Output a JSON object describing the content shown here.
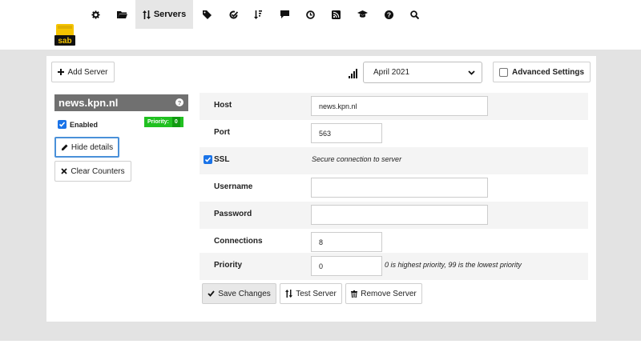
{
  "nav": {
    "logo_text": "sab",
    "active_label": "Servers",
    "icons": [
      "gear-icon",
      "folder-icon",
      "servers-icon",
      "tag-icon",
      "check-circle-icon",
      "sort-icon",
      "comment-icon",
      "clock-icon",
      "rss-icon",
      "graduation-cap-icon",
      "question-circle-icon",
      "search-icon"
    ]
  },
  "toolbar": {
    "add_server_label": "Add Server",
    "month_select": "April 2021",
    "advanced_settings_label": "Advanced Settings",
    "advanced_settings_checked": false
  },
  "server": {
    "name": "news.kpn.nl",
    "enabled_label": "Enabled",
    "enabled_checked": true,
    "priority_badge_label": "Priority:",
    "priority_badge_value": "0",
    "hide_details_label": "Hide details",
    "clear_counters_label": "Clear Counters"
  },
  "form": {
    "host_label": "Host",
    "host_value": "news.kpn.nl",
    "port_label": "Port",
    "port_value": "563",
    "ssl_label": "SSL",
    "ssl_checked": true,
    "ssl_hint": "Secure connection to server",
    "username_label": "Username",
    "username_value": "",
    "password_label": "Password",
    "password_value": "",
    "connections_label": "Connections",
    "connections_value": "8",
    "priority_label": "Priority",
    "priority_value": "0",
    "priority_hint": "0 is highest priority, 99 is the lowest priority"
  },
  "actions": {
    "save_label": "Save Changes",
    "test_label": "Test Server",
    "remove_label": "Remove Server"
  },
  "colors": {
    "accent_blue": "#1a73e8",
    "badge_green": "#20c020",
    "header_gray": "#707070",
    "page_gray": "#e3e3e3",
    "logo_yellow": "#f5c400"
  }
}
